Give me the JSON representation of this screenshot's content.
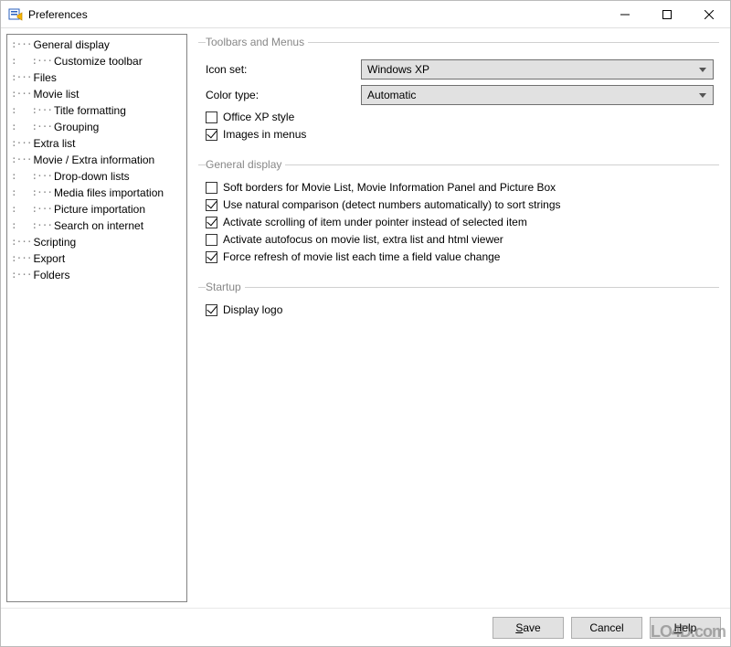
{
  "window": {
    "title": "Preferences"
  },
  "tree": {
    "items": [
      {
        "label": "General display",
        "depth": 0,
        "last": false
      },
      {
        "label": "Customize toolbar",
        "depth": 1,
        "last": true
      },
      {
        "label": "Files",
        "depth": 0,
        "last": false
      },
      {
        "label": "Movie list",
        "depth": 0,
        "last": false
      },
      {
        "label": "Title formatting",
        "depth": 1,
        "last": false
      },
      {
        "label": "Grouping",
        "depth": 1,
        "last": true
      },
      {
        "label": "Extra list",
        "depth": 0,
        "last": false
      },
      {
        "label": "Movie / Extra information",
        "depth": 0,
        "last": false
      },
      {
        "label": "Drop-down lists",
        "depth": 1,
        "last": false
      },
      {
        "label": "Media files importation",
        "depth": 1,
        "last": false
      },
      {
        "label": "Picture importation",
        "depth": 1,
        "last": false
      },
      {
        "label": "Search on internet",
        "depth": 1,
        "last": true
      },
      {
        "label": "Scripting",
        "depth": 0,
        "last": false
      },
      {
        "label": "Export",
        "depth": 0,
        "last": false
      },
      {
        "label": "Folders",
        "depth": 0,
        "last": true
      }
    ]
  },
  "groups": {
    "toolbars": {
      "legend": "Toolbars and Menus",
      "iconset_label": "Icon set:",
      "iconset_value": "Windows XP",
      "colortype_label": "Color type:",
      "colortype_value": "Automatic",
      "officexp_label": "Office XP style",
      "officexp_checked": false,
      "imagesmenus_label": "Images in menus",
      "imagesmenus_checked": true
    },
    "general": {
      "legend": "General display",
      "softborders_label": "Soft borders for Movie List, Movie Information Panel and Picture Box",
      "softborders_checked": false,
      "naturalcmp_label": "Use natural comparison (detect numbers automatically) to sort strings",
      "naturalcmp_checked": true,
      "scrollptr_label": "Activate scrolling of item under pointer instead of selected item",
      "scrollptr_checked": true,
      "autofocus_label": "Activate autofocus on movie list, extra list and html viewer",
      "autofocus_checked": false,
      "forcerefresh_label": "Force refresh of movie list each time a field value change",
      "forcerefresh_checked": true
    },
    "startup": {
      "legend": "Startup",
      "displaylogo_label": "Display logo",
      "displaylogo_checked": true
    }
  },
  "buttons": {
    "save": "Save",
    "cancel": "Cancel",
    "help": "Help"
  },
  "watermark": "LO4D.com"
}
